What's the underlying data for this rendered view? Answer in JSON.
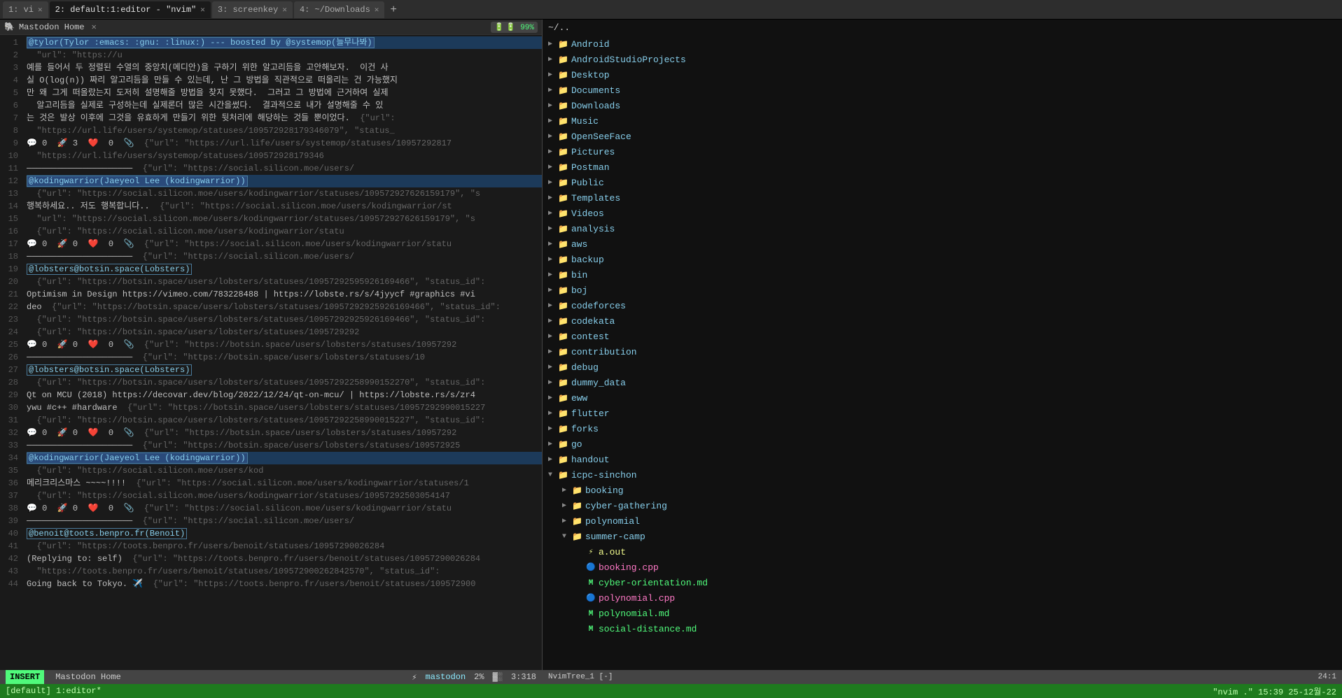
{
  "tabs": [
    {
      "id": 1,
      "label": "1: vi",
      "active": false,
      "closeable": true
    },
    {
      "id": 2,
      "label": "2: default:1:editor - \"nvim\"",
      "active": true,
      "closeable": true
    },
    {
      "id": 3,
      "label": "3: screenkey",
      "active": false,
      "closeable": true
    },
    {
      "id": 4,
      "label": "4: ~/Downloads",
      "active": false,
      "closeable": true
    }
  ],
  "new_tab_label": "+",
  "window_title": "Mastodon Home",
  "window_close": "✕",
  "battery": "🔋 99%",
  "editor": {
    "lines": [
      {
        "n": 1,
        "text": "@tylor(Tylor :emacs: :gnu: :linux:) --- boosted by @systemop(늘무나봐)",
        "type": "user-highlight"
      },
      {
        "n": 2,
        "text": "  \"url\": \"https://u"
      },
      {
        "n": 3,
        "text": "예를 들어서 두 정렬된 수열의 중앙치(메디안)을 구하기 위한 알고리듬을 고안해보자.  이건 사"
      },
      {
        "n": 4,
        "text": "실 O(log(n)) 짜리 알고리듬을 만들 수 있는데, 난 그 방법을 직관적으로 떠올리는 건 가능했지"
      },
      {
        "n": 5,
        "text": "만 왜 그게 떠올랐는지 도저히 설명해줄 방법을 찾지 못했다.  그러고 그 방법에 근거하여 실제"
      },
      {
        "n": 6,
        "text": "  알고리듬을 실제로 구성하는데 실제론더 많은 시간을썼다.  결과적으로 내가 설명해줄 수 있"
      },
      {
        "n": 7,
        "text": "는 것은 발상 이후에 그것을 유효하게 만들기 위한 뒷처리에 해당하는 것들 뿐이었다.  {\"url\":"
      },
      {
        "n": 8,
        "text": "  \"https://url.life/users/systemop/statuses/109572928179346079\", \"status_"
      },
      {
        "n": 9,
        "text": "💬 0  🚀 3  ❤️  0  📎  {\"url\": \"https://url.life/users/systemop/statuses/10957292817"
      },
      {
        "n": 10,
        "text": "  \"https://url.life/users/systemop/statuses/109572928179346"
      },
      {
        "n": 11,
        "text": "─────────────────────  {\"url\": \"https://social.silicon.moe/users/"
      },
      {
        "n": 12,
        "text": "@kodingwarrior(Jaeyeol Lee (kodingwarrior))",
        "type": "user-highlight"
      },
      {
        "n": 13,
        "text": "  {\"url\": \"https://social.silicon.moe/users/kodingwarrior/statuses/109572927626159179\", \"s"
      },
      {
        "n": 14,
        "text": "행복하세요.. 저도 행복합니다..  {\"url\": \"https://social.silicon.moe/users/kodingwarrior/st"
      },
      {
        "n": 15,
        "text": "  \"url\": \"https://social.silicon.moe/users/kodingwarrior/statuses/109572927626159179\", \"s"
      },
      {
        "n": 16,
        "text": "  {\"url\": \"https://social.silicon.moe/users/kodingwarrior/statu"
      },
      {
        "n": 17,
        "text": "💬 0  🚀 0  ❤️  0  📎  {\"url\": \"https://social.silicon.moe/users/kodingwarrior/statu"
      },
      {
        "n": 18,
        "text": "─────────────────────  {\"url\": \"https://social.silicon.moe/users/"
      },
      {
        "n": 19,
        "text": "@lobsters@botsin.space(Lobsters)",
        "type": "user-highlight2"
      },
      {
        "n": 20,
        "text": "  {\"url\": \"https://botsin.space/users/lobsters/statuses/10957292595926169466\", \"status_id\":"
      },
      {
        "n": 21,
        "text": "Optimism in Design https://vimeo.com/783228488 | https://lobste.rs/s/4jyycf #graphics #vi"
      },
      {
        "n": 22,
        "text": "deo  {\"url\": \"https://botsin.space/users/lobsters/statuses/10957292925926169466\", \"status_id\":"
      },
      {
        "n": 23,
        "text": "  {\"url\": \"https://botsin.space/users/lobsters/statuses/10957292925926169466\", \"status_id\":"
      },
      {
        "n": 24,
        "text": "  {\"url\": \"https://botsin.space/users/lobsters/statuses/1095729292"
      },
      {
        "n": 25,
        "text": "💬 0  🚀 0  ❤️  0  📎  {\"url\": \"https://botsin.space/users/lobsters/statuses/10957292"
      },
      {
        "n": 26,
        "text": "─────────────────────  {\"url\": \"https://botsin.space/users/lobsters/statuses/10"
      },
      {
        "n": 27,
        "text": "@lobsters@botsin.space(Lobsters)",
        "type": "user-highlight2"
      },
      {
        "n": 28,
        "text": "  {\"url\": \"https://botsin.space/users/lobsters/statuses/10957292258990152270\", \"status_id\":"
      },
      {
        "n": 29,
        "text": "Qt on MCU (2018) https://decovar.dev/blog/2022/12/24/qt-on-mcu/ | https://lobste.rs/s/zr4"
      },
      {
        "n": 30,
        "text": "ywu #c++ #hardware  {\"url\": \"https://botsin.space/users/lobsters/statuses/10957292990015227"
      },
      {
        "n": 31,
        "text": "  {\"url\": \"https://botsin.space/users/lobsters/statuses/10957292258990015227\", \"status_id\":"
      },
      {
        "n": 32,
        "text": "💬 0  🚀 0  ❤️  0  📎  {\"url\": \"https://botsin.space/users/lobsters/statuses/10957292"
      },
      {
        "n": 33,
        "text": "─────────────────────  {\"url\": \"https://botsin.space/users/lobsters/statuses/109572925"
      },
      {
        "n": 34,
        "text": "@kodingwarrior(Jaeyeol Lee (kodingwarrior))",
        "type": "user-highlight"
      },
      {
        "n": 35,
        "text": "  {\"url\": \"https://social.silicon.moe/users/kod"
      },
      {
        "n": 36,
        "text": "메리크리스마스 ~~~~!!!!  {\"url\": \"https://social.silicon.moe/users/kodingwarrior/statuses/1"
      },
      {
        "n": 37,
        "text": "  {\"url\": \"https://social.silicon.moe/users/kodingwarrior/statuses/10957292503054147"
      },
      {
        "n": 38,
        "text": "💬 0  🚀 0  ❤️  0  📎  {\"url\": \"https://social.silicon.moe/users/kodingwarrior/statu"
      },
      {
        "n": 39,
        "text": "─────────────────────  {\"url\": \"https://social.silicon.moe/users/"
      },
      {
        "n": 40,
        "text": "@benoit@toots.benpro.fr(Benoit)",
        "type": "user-highlight2"
      },
      {
        "n": 41,
        "text": "  {\"url\": \"https://toots.benpro.fr/users/benoit/statuses/10957290026284"
      },
      {
        "n": 42,
        "text": "(Replying to: self)  {\"url\": \"https://toots.benpro.fr/users/benoit/statuses/10957290026284"
      },
      {
        "n": 43,
        "text": "  \"https://toots.benpro.fr/users/benoit/statuses/109572900262842570\", \"status_id\":"
      },
      {
        "n": 44,
        "text": "Going back to Tokyo. ✈️  {\"url\": \"https://toots.benpro.fr/users/benoit/statuses/109572900"
      }
    ],
    "status": {
      "mode": "INSERT",
      "title": "Mastodon Home",
      "indicator": "⚡",
      "percent": "2%",
      "cursor": "3:318",
      "tree_label": "NvimTree_1 [-]",
      "position": "24:1"
    }
  },
  "file_tree": {
    "root": "~/..",
    "items": [
      {
        "level": 0,
        "type": "folder",
        "name": "Android",
        "expanded": false,
        "arrow": "▶"
      },
      {
        "level": 0,
        "type": "folder",
        "name": "AndroidStudioProjects",
        "expanded": false,
        "arrow": "▶"
      },
      {
        "level": 0,
        "type": "folder",
        "name": "Desktop",
        "expanded": false,
        "arrow": "▶"
      },
      {
        "level": 0,
        "type": "folder",
        "name": "Documents",
        "expanded": false,
        "arrow": "▶"
      },
      {
        "level": 0,
        "type": "folder",
        "name": "Downloads",
        "expanded": false,
        "arrow": "▶"
      },
      {
        "level": 0,
        "type": "folder",
        "name": "Music",
        "expanded": false,
        "arrow": "▶"
      },
      {
        "level": 0,
        "type": "folder",
        "name": "OpenSeeFace",
        "expanded": false,
        "arrow": "▶"
      },
      {
        "level": 0,
        "type": "folder",
        "name": "Pictures",
        "expanded": false,
        "arrow": "▶"
      },
      {
        "level": 0,
        "type": "folder",
        "name": "Postman",
        "expanded": false,
        "arrow": "▶"
      },
      {
        "level": 0,
        "type": "folder",
        "name": "Public",
        "expanded": false,
        "arrow": "▶"
      },
      {
        "level": 0,
        "type": "folder",
        "name": "Templates",
        "expanded": false,
        "arrow": "▶"
      },
      {
        "level": 0,
        "type": "folder",
        "name": "Videos",
        "expanded": false,
        "arrow": "▶"
      },
      {
        "level": 0,
        "type": "folder",
        "name": "analysis",
        "expanded": false,
        "arrow": "▶"
      },
      {
        "level": 0,
        "type": "folder",
        "name": "aws",
        "expanded": false,
        "arrow": "▶"
      },
      {
        "level": 0,
        "type": "folder",
        "name": "backup",
        "expanded": false,
        "arrow": "▶"
      },
      {
        "level": 0,
        "type": "folder",
        "name": "bin",
        "expanded": false,
        "arrow": "▶"
      },
      {
        "level": 0,
        "type": "folder",
        "name": "boj",
        "expanded": false,
        "arrow": "▶"
      },
      {
        "level": 0,
        "type": "folder",
        "name": "codeforces",
        "expanded": false,
        "arrow": "▶"
      },
      {
        "level": 0,
        "type": "folder",
        "name": "codekata",
        "expanded": false,
        "arrow": "▶"
      },
      {
        "level": 0,
        "type": "folder",
        "name": "contest",
        "expanded": false,
        "arrow": "▶"
      },
      {
        "level": 0,
        "type": "folder",
        "name": "contribution",
        "expanded": false,
        "arrow": "▶"
      },
      {
        "level": 0,
        "type": "folder",
        "name": "debug",
        "expanded": false,
        "arrow": "▶"
      },
      {
        "level": 0,
        "type": "folder",
        "name": "dummy_data",
        "expanded": false,
        "arrow": "▶"
      },
      {
        "level": 0,
        "type": "folder",
        "name": "eww",
        "expanded": false,
        "arrow": "▶"
      },
      {
        "level": 0,
        "type": "folder",
        "name": "flutter",
        "expanded": false,
        "arrow": "▶"
      },
      {
        "level": 0,
        "type": "folder",
        "name": "forks",
        "expanded": false,
        "arrow": "▶"
      },
      {
        "level": 0,
        "type": "folder",
        "name": "go",
        "expanded": false,
        "arrow": "▶"
      },
      {
        "level": 0,
        "type": "folder",
        "name": "handout",
        "expanded": false,
        "arrow": "▶"
      },
      {
        "level": 0,
        "type": "folder",
        "name": "icpc-sinchon",
        "expanded": true,
        "arrow": "▼"
      },
      {
        "level": 1,
        "type": "folder",
        "name": "booking",
        "expanded": false,
        "arrow": "▶"
      },
      {
        "level": 1,
        "type": "folder",
        "name": "cyber-gathering",
        "expanded": false,
        "arrow": "▶"
      },
      {
        "level": 1,
        "type": "folder",
        "name": "polynomial",
        "expanded": false,
        "arrow": "▶"
      },
      {
        "level": 1,
        "type": "folder",
        "name": "summer-camp",
        "expanded": true,
        "arrow": "▼"
      },
      {
        "level": 2,
        "type": "file",
        "name": "a.out",
        "ext": "out"
      },
      {
        "level": 2,
        "type": "file",
        "name": "booking.cpp",
        "ext": "cpp"
      },
      {
        "level": 2,
        "type": "file",
        "name": "cyber-orientation.md",
        "ext": "md"
      },
      {
        "level": 2,
        "type": "file",
        "name": "polynomial.cpp",
        "ext": "cpp"
      },
      {
        "level": 2,
        "type": "file",
        "name": "polynomial.md",
        "ext": "md"
      },
      {
        "level": 2,
        "type": "file",
        "name": "social-distance.md",
        "ext": "md"
      }
    ]
  },
  "global_status": {
    "left": "[default] 1:editor*",
    "right": "\"nvim .\"  15:39 25-12월-22"
  }
}
